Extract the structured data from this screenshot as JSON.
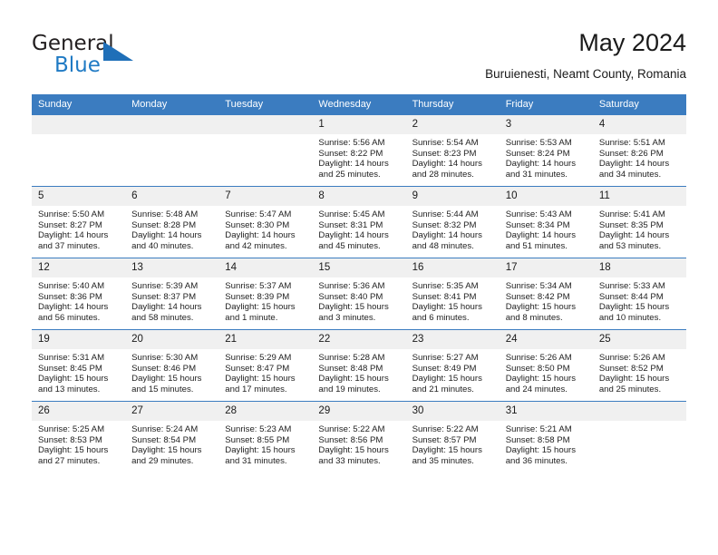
{
  "branding": {
    "logo_primary": "General",
    "logo_secondary": "Blue",
    "logo_triangle_color": "#1f6fb8",
    "logo_secondary_color": "#1f7ac4"
  },
  "header": {
    "title": "May 2024",
    "subtitle": "Buruienesti, Neamt County, Romania"
  },
  "theme": {
    "header_blue": "#3b7cc0",
    "daynum_band": "#f0f0f0",
    "text": "#1a1a1a"
  },
  "weekdays": [
    "Sunday",
    "Monday",
    "Tuesday",
    "Wednesday",
    "Thursday",
    "Friday",
    "Saturday"
  ],
  "labels": {
    "sunrise": "Sunrise:",
    "sunset": "Sunset:",
    "daylight": "Daylight:"
  },
  "weeks": [
    [
      {
        "day": ""
      },
      {
        "day": ""
      },
      {
        "day": ""
      },
      {
        "day": "1",
        "sunrise": "Sunrise: 5:56 AM",
        "sunset": "Sunset: 8:22 PM",
        "daylight": "Daylight: 14 hours and 25 minutes."
      },
      {
        "day": "2",
        "sunrise": "Sunrise: 5:54 AM",
        "sunset": "Sunset: 8:23 PM",
        "daylight": "Daylight: 14 hours and 28 minutes."
      },
      {
        "day": "3",
        "sunrise": "Sunrise: 5:53 AM",
        "sunset": "Sunset: 8:24 PM",
        "daylight": "Daylight: 14 hours and 31 minutes."
      },
      {
        "day": "4",
        "sunrise": "Sunrise: 5:51 AM",
        "sunset": "Sunset: 8:26 PM",
        "daylight": "Daylight: 14 hours and 34 minutes."
      }
    ],
    [
      {
        "day": "5",
        "sunrise": "Sunrise: 5:50 AM",
        "sunset": "Sunset: 8:27 PM",
        "daylight": "Daylight: 14 hours and 37 minutes."
      },
      {
        "day": "6",
        "sunrise": "Sunrise: 5:48 AM",
        "sunset": "Sunset: 8:28 PM",
        "daylight": "Daylight: 14 hours and 40 minutes."
      },
      {
        "day": "7",
        "sunrise": "Sunrise: 5:47 AM",
        "sunset": "Sunset: 8:30 PM",
        "daylight": "Daylight: 14 hours and 42 minutes."
      },
      {
        "day": "8",
        "sunrise": "Sunrise: 5:45 AM",
        "sunset": "Sunset: 8:31 PM",
        "daylight": "Daylight: 14 hours and 45 minutes."
      },
      {
        "day": "9",
        "sunrise": "Sunrise: 5:44 AM",
        "sunset": "Sunset: 8:32 PM",
        "daylight": "Daylight: 14 hours and 48 minutes."
      },
      {
        "day": "10",
        "sunrise": "Sunrise: 5:43 AM",
        "sunset": "Sunset: 8:34 PM",
        "daylight": "Daylight: 14 hours and 51 minutes."
      },
      {
        "day": "11",
        "sunrise": "Sunrise: 5:41 AM",
        "sunset": "Sunset: 8:35 PM",
        "daylight": "Daylight: 14 hours and 53 minutes."
      }
    ],
    [
      {
        "day": "12",
        "sunrise": "Sunrise: 5:40 AM",
        "sunset": "Sunset: 8:36 PM",
        "daylight": "Daylight: 14 hours and 56 minutes."
      },
      {
        "day": "13",
        "sunrise": "Sunrise: 5:39 AM",
        "sunset": "Sunset: 8:37 PM",
        "daylight": "Daylight: 14 hours and 58 minutes."
      },
      {
        "day": "14",
        "sunrise": "Sunrise: 5:37 AM",
        "sunset": "Sunset: 8:39 PM",
        "daylight": "Daylight: 15 hours and 1 minute."
      },
      {
        "day": "15",
        "sunrise": "Sunrise: 5:36 AM",
        "sunset": "Sunset: 8:40 PM",
        "daylight": "Daylight: 15 hours and 3 minutes."
      },
      {
        "day": "16",
        "sunrise": "Sunrise: 5:35 AM",
        "sunset": "Sunset: 8:41 PM",
        "daylight": "Daylight: 15 hours and 6 minutes."
      },
      {
        "day": "17",
        "sunrise": "Sunrise: 5:34 AM",
        "sunset": "Sunset: 8:42 PM",
        "daylight": "Daylight: 15 hours and 8 minutes."
      },
      {
        "day": "18",
        "sunrise": "Sunrise: 5:33 AM",
        "sunset": "Sunset: 8:44 PM",
        "daylight": "Daylight: 15 hours and 10 minutes."
      }
    ],
    [
      {
        "day": "19",
        "sunrise": "Sunrise: 5:31 AM",
        "sunset": "Sunset: 8:45 PM",
        "daylight": "Daylight: 15 hours and 13 minutes."
      },
      {
        "day": "20",
        "sunrise": "Sunrise: 5:30 AM",
        "sunset": "Sunset: 8:46 PM",
        "daylight": "Daylight: 15 hours and 15 minutes."
      },
      {
        "day": "21",
        "sunrise": "Sunrise: 5:29 AM",
        "sunset": "Sunset: 8:47 PM",
        "daylight": "Daylight: 15 hours and 17 minutes."
      },
      {
        "day": "22",
        "sunrise": "Sunrise: 5:28 AM",
        "sunset": "Sunset: 8:48 PM",
        "daylight": "Daylight: 15 hours and 19 minutes."
      },
      {
        "day": "23",
        "sunrise": "Sunrise: 5:27 AM",
        "sunset": "Sunset: 8:49 PM",
        "daylight": "Daylight: 15 hours and 21 minutes."
      },
      {
        "day": "24",
        "sunrise": "Sunrise: 5:26 AM",
        "sunset": "Sunset: 8:50 PM",
        "daylight": "Daylight: 15 hours and 24 minutes."
      },
      {
        "day": "25",
        "sunrise": "Sunrise: 5:26 AM",
        "sunset": "Sunset: 8:52 PM",
        "daylight": "Daylight: 15 hours and 25 minutes."
      }
    ],
    [
      {
        "day": "26",
        "sunrise": "Sunrise: 5:25 AM",
        "sunset": "Sunset: 8:53 PM",
        "daylight": "Daylight: 15 hours and 27 minutes."
      },
      {
        "day": "27",
        "sunrise": "Sunrise: 5:24 AM",
        "sunset": "Sunset: 8:54 PM",
        "daylight": "Daylight: 15 hours and 29 minutes."
      },
      {
        "day": "28",
        "sunrise": "Sunrise: 5:23 AM",
        "sunset": "Sunset: 8:55 PM",
        "daylight": "Daylight: 15 hours and 31 minutes."
      },
      {
        "day": "29",
        "sunrise": "Sunrise: 5:22 AM",
        "sunset": "Sunset: 8:56 PM",
        "daylight": "Daylight: 15 hours and 33 minutes."
      },
      {
        "day": "30",
        "sunrise": "Sunrise: 5:22 AM",
        "sunset": "Sunset: 8:57 PM",
        "daylight": "Daylight: 15 hours and 35 minutes."
      },
      {
        "day": "31",
        "sunrise": "Sunrise: 5:21 AM",
        "sunset": "Sunset: 8:58 PM",
        "daylight": "Daylight: 15 hours and 36 minutes."
      },
      {
        "day": ""
      }
    ]
  ]
}
